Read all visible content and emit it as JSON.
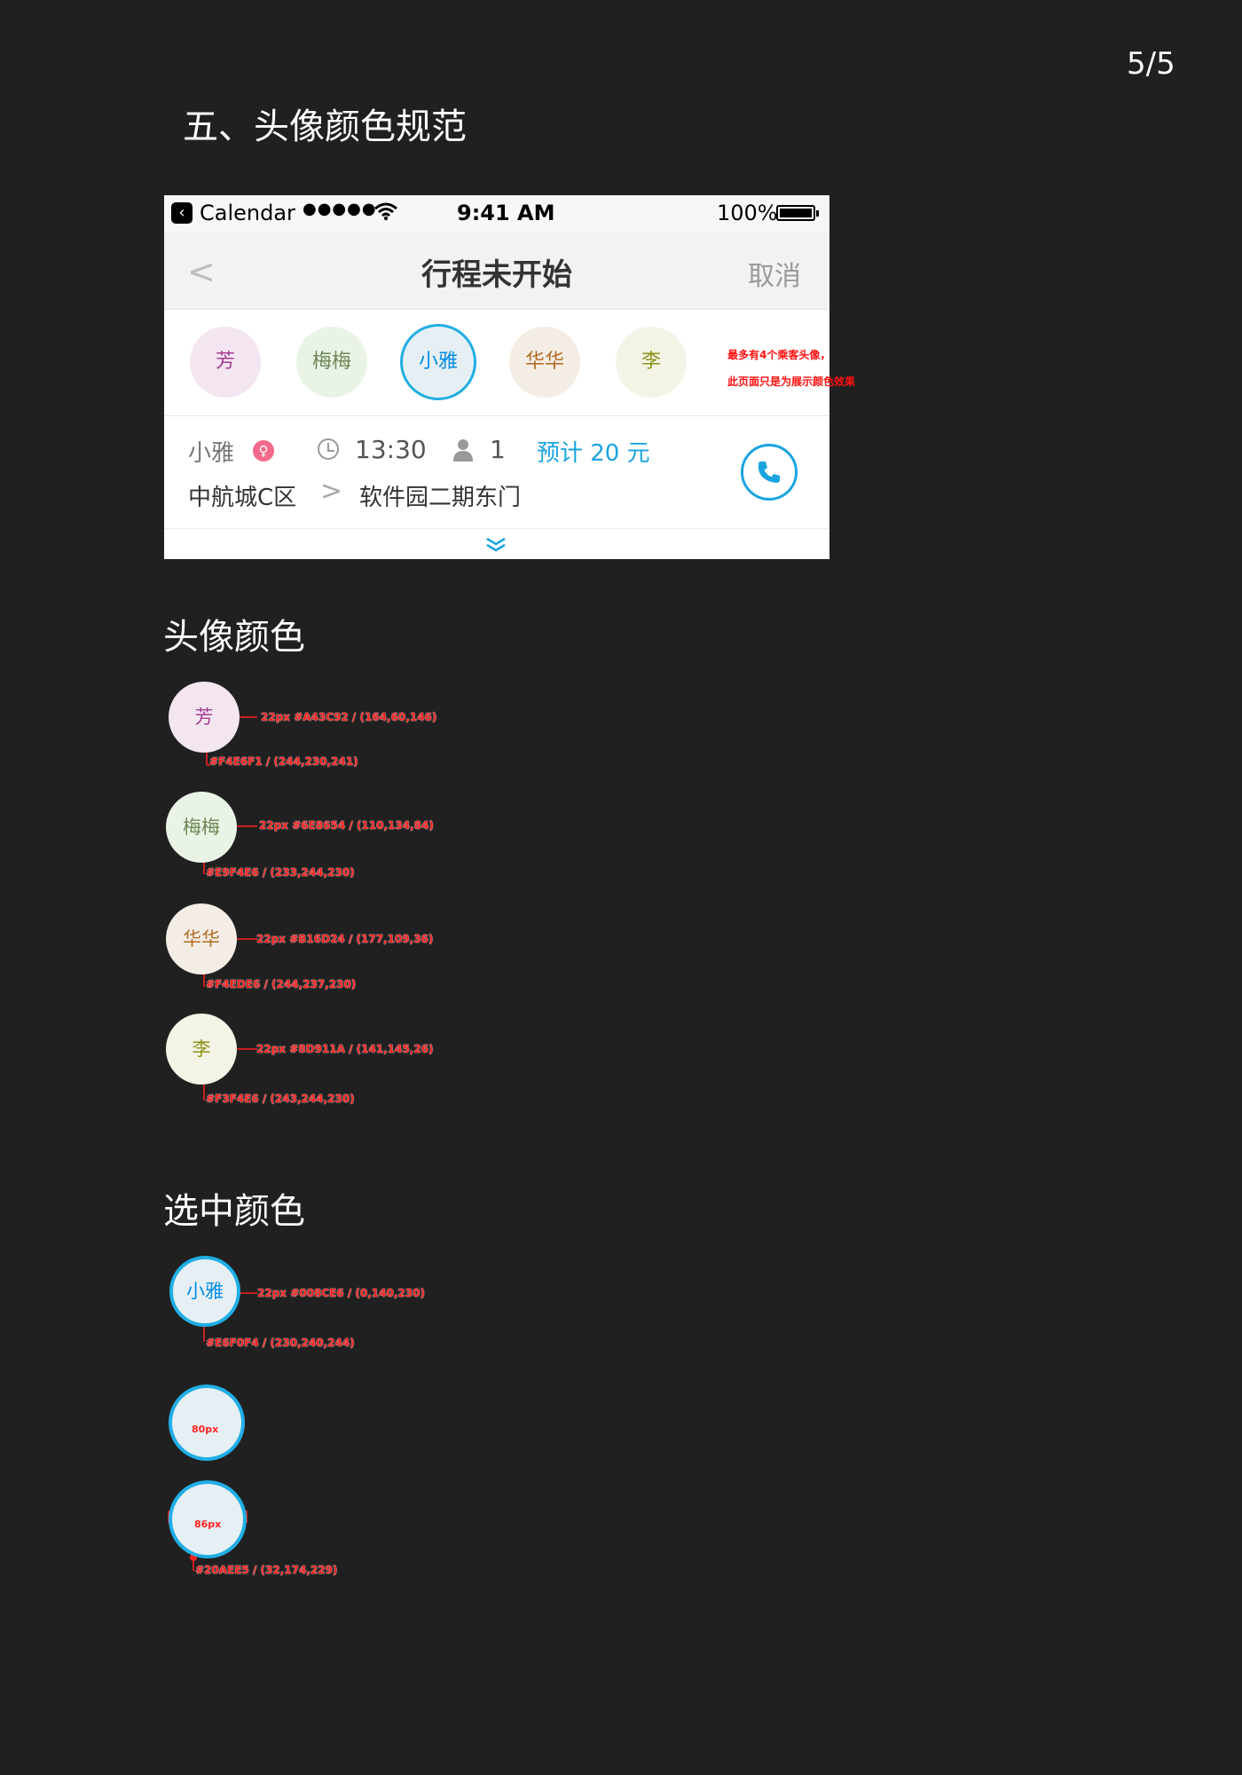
{
  "page_number": "5/5",
  "section_title": "五、头像颜色规范",
  "status_bar": {
    "carrier": "Calendar",
    "signal": "●●●●●",
    "time": "9:41 AM",
    "battery": "100%"
  },
  "navbar": {
    "back": "<",
    "title": "行程未开始",
    "cancel": "取消"
  },
  "avatars": [
    {
      "name": "芳",
      "text_color": "#A43C92",
      "bg": "#F4E6F1",
      "selected": false
    },
    {
      "name": "梅梅",
      "text_color": "#6E8654",
      "bg": "#E9F4E6",
      "selected": false
    },
    {
      "name": "小雅",
      "text_color": "#008CE6",
      "bg": "#E6F0F4",
      "selected": true
    },
    {
      "name": "华华",
      "text_color": "#B16D24",
      "bg": "#F4EDE6",
      "selected": false
    },
    {
      "name": "李",
      "text_color": "#8D911A",
      "bg": "#F3F4E6",
      "selected": false
    }
  ],
  "avatar_note": {
    "line1": "最多有4个乘客头像，",
    "line2": "此页面只是为展示颜色效果"
  },
  "trip": {
    "name": "小雅",
    "badge": "♀",
    "time": "13:30",
    "passengers": "1",
    "price": "预计 20 元",
    "from": "中航城C区",
    "arrow": ">",
    "to": "软件园二期东门"
  },
  "avatar_colors": {
    "heading": "头像颜色",
    "items": [
      {
        "name": "芳",
        "text_spec": "22px #A43C92 / (164,60,146)",
        "bg_spec": "#F4E6F1 / (244,230,241)",
        "text_color": "#A43C92",
        "bg": "#F4E6F1"
      },
      {
        "name": "梅梅",
        "text_spec": "22px #6E8654 / (110,134,84)",
        "bg_spec": "#E9F4E6 / (233,244,230)",
        "text_color": "#6E8654",
        "bg": "#E9F4E6"
      },
      {
        "name": "华华",
        "text_spec": "22px #B16D24 / (177,109,36)",
        "bg_spec": "#F4EDE6 / (244,237,230)",
        "text_color": "#B16D24",
        "bg": "#F4EDE6"
      },
      {
        "name": "李",
        "text_spec": "22px #8D911A / (141,145,26)",
        "bg_spec": "#F3F4E6 / (243,244,230)",
        "text_color": "#8D911A",
        "bg": "#F3F4E6"
      }
    ]
  },
  "selected_colors": {
    "heading": "选中颜色",
    "name": "小雅",
    "text_spec": "22px #008CE6 / (0,140,230)",
    "bg_spec": "#E6F0F4 / (230,240,244)",
    "inner_size": "80px",
    "outer_size": "86px",
    "border_spec": "#20AEE5 / (32,174,229)",
    "text_color": "#008CE6",
    "bg": "#E6F0F4",
    "border_color": "#20AEE5"
  }
}
